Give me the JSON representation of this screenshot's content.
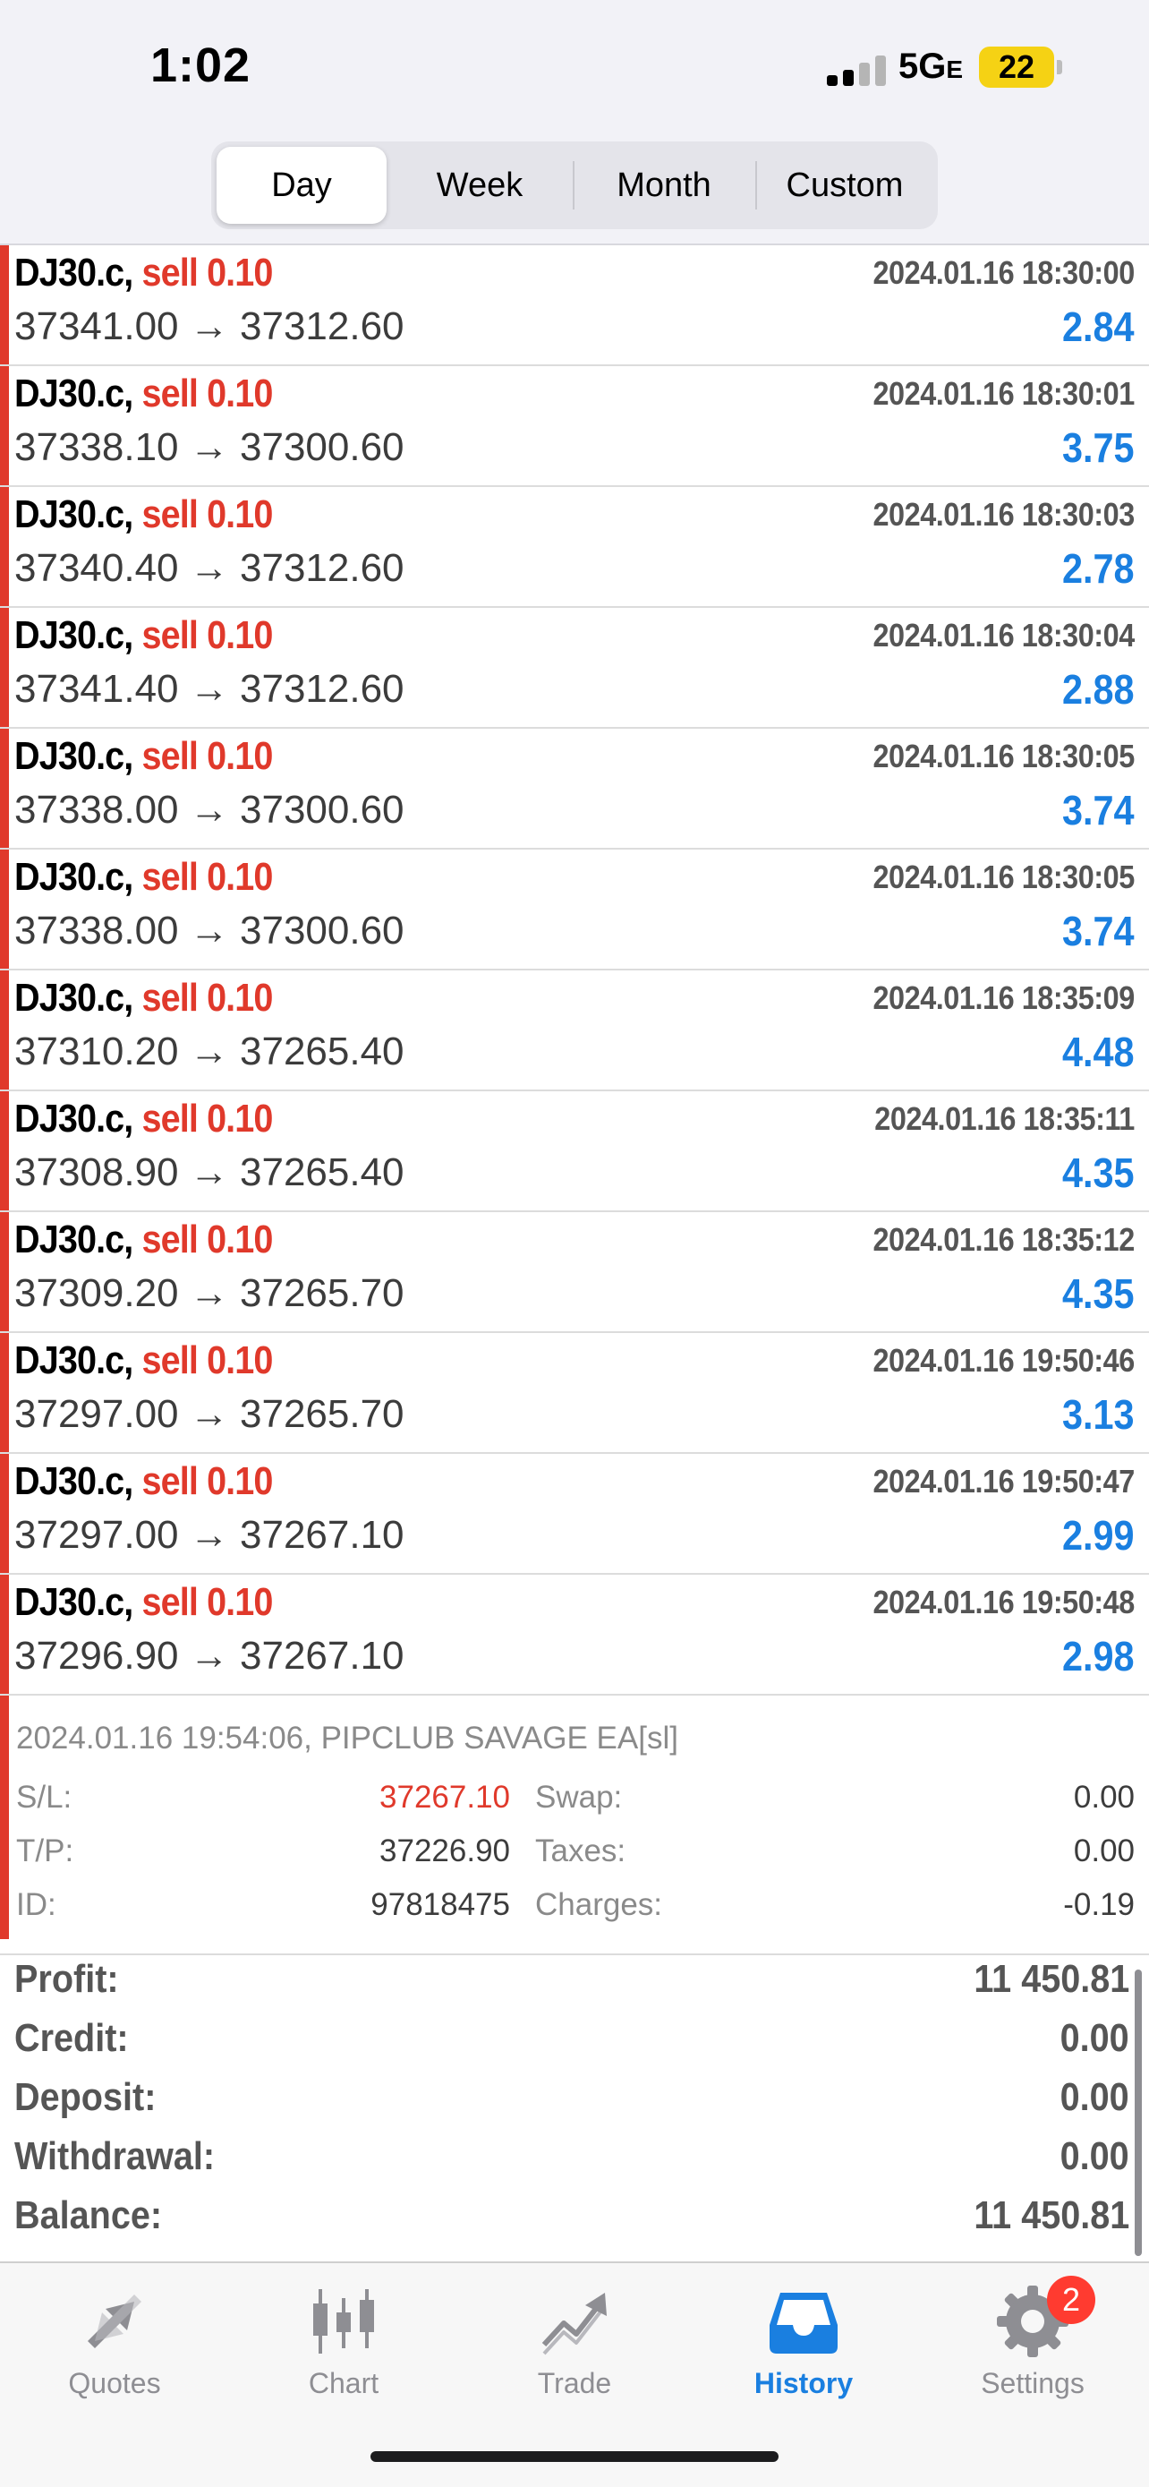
{
  "status_bar": {
    "time": "1:02",
    "network": "5G",
    "network_suffix": "E",
    "battery": "22"
  },
  "periods": {
    "day": "Day",
    "week": "Week",
    "month": "Month",
    "custom": "Custom",
    "selected": "Day"
  },
  "deals": [
    {
      "symbol": "DJ30.c,",
      "type": "sell 0.10",
      "time": "2024.01.16 18:30:00",
      "open": "37341.00",
      "close": "37312.60",
      "profit": "2.84"
    },
    {
      "symbol": "DJ30.c,",
      "type": "sell 0.10",
      "time": "2024.01.16 18:30:01",
      "open": "37338.10",
      "close": "37300.60",
      "profit": "3.75"
    },
    {
      "symbol": "DJ30.c,",
      "type": "sell 0.10",
      "time": "2024.01.16 18:30:03",
      "open": "37340.40",
      "close": "37312.60",
      "profit": "2.78"
    },
    {
      "symbol": "DJ30.c,",
      "type": "sell 0.10",
      "time": "2024.01.16 18:30:04",
      "open": "37341.40",
      "close": "37312.60",
      "profit": "2.88"
    },
    {
      "symbol": "DJ30.c,",
      "type": "sell 0.10",
      "time": "2024.01.16 18:30:05",
      "open": "37338.00",
      "close": "37300.60",
      "profit": "3.74"
    },
    {
      "symbol": "DJ30.c,",
      "type": "sell 0.10",
      "time": "2024.01.16 18:30:05",
      "open": "37338.00",
      "close": "37300.60",
      "profit": "3.74"
    },
    {
      "symbol": "DJ30.c,",
      "type": "sell 0.10",
      "time": "2024.01.16 18:35:09",
      "open": "37310.20",
      "close": "37265.40",
      "profit": "4.48"
    },
    {
      "symbol": "DJ30.c,",
      "type": "sell 0.10",
      "time": "2024.01.16 18:35:11",
      "open": "37308.90",
      "close": "37265.40",
      "profit": "4.35"
    },
    {
      "symbol": "DJ30.c,",
      "type": "sell 0.10",
      "time": "2024.01.16 18:35:12",
      "open": "37309.20",
      "close": "37265.70",
      "profit": "4.35"
    },
    {
      "symbol": "DJ30.c,",
      "type": "sell 0.10",
      "time": "2024.01.16 19:50:46",
      "open": "37297.00",
      "close": "37265.70",
      "profit": "3.13"
    },
    {
      "symbol": "DJ30.c,",
      "type": "sell 0.10",
      "time": "2024.01.16 19:50:47",
      "open": "37297.00",
      "close": "37267.10",
      "profit": "2.99"
    },
    {
      "symbol": "DJ30.c,",
      "type": "sell 0.10",
      "time": "2024.01.16 19:50:48",
      "open": "37296.90",
      "close": "37267.10",
      "profit": "2.98"
    }
  ],
  "arrow": "→",
  "detail": {
    "comment": "2024.01.16 19:54:06, PIPCLUB SAVAGE EA[sl]",
    "sl_label": "S/L:",
    "sl": "37267.10",
    "tp_label": "T/P:",
    "tp": "37226.90",
    "id_label": "ID:",
    "id": "97818475",
    "swap_label": "Swap:",
    "swap": "0.00",
    "taxes_label": "Taxes:",
    "taxes": "0.00",
    "charges_label": "Charges:",
    "charges": "-0.19"
  },
  "summary": {
    "profit_label": "Profit:",
    "profit": "11 450.81",
    "credit_label": "Credit:",
    "credit": "0.00",
    "deposit_label": "Deposit:",
    "deposit": "0.00",
    "withdrawal_label": "Withdrawal:",
    "withdrawal": "0.00",
    "balance_label": "Balance:",
    "balance": "11 450.81"
  },
  "tabs": {
    "quotes": "Quotes",
    "chart": "Chart",
    "trade": "Trade",
    "history": "History",
    "settings": "Settings",
    "settings_badge": "2",
    "active": "History"
  },
  "colors": {
    "sell": "#e0392b",
    "profit": "#1a7fe0",
    "accent": "#1a7fe0",
    "badge": "#ff3b30",
    "battery": "#f5d214"
  }
}
